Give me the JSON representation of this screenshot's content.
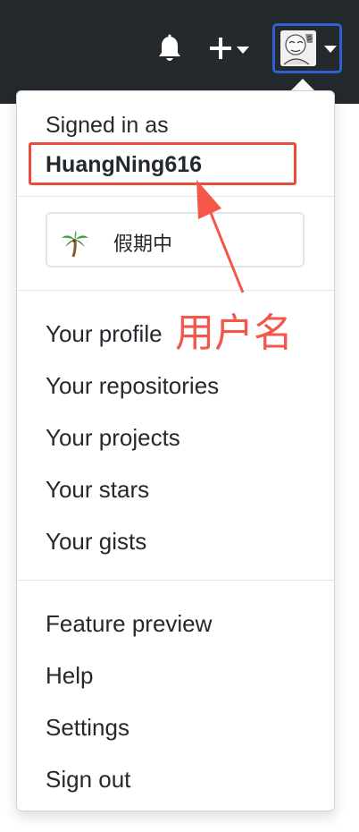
{
  "header": {
    "notifications_icon": "bell-icon",
    "create_icon": "plus-icon",
    "avatar_icon": "user-avatar"
  },
  "dropdown": {
    "signed_in_label": "Signed in as",
    "username": "HuangNing616",
    "status": {
      "emoji_icon": "palm-tree-icon",
      "text": "假期中"
    },
    "profile_section": [
      "Your profile",
      "Your repositories",
      "Your projects",
      "Your stars",
      "Your gists"
    ],
    "settings_section": [
      "Feature preview",
      "Help",
      "Settings",
      "Sign out"
    ]
  },
  "annotation": {
    "label": "用户名",
    "color": "#f4564a"
  },
  "colors": {
    "header_bg": "#24292e",
    "avatar_border": "#2f5fd0",
    "highlight": "#e84c3d"
  }
}
